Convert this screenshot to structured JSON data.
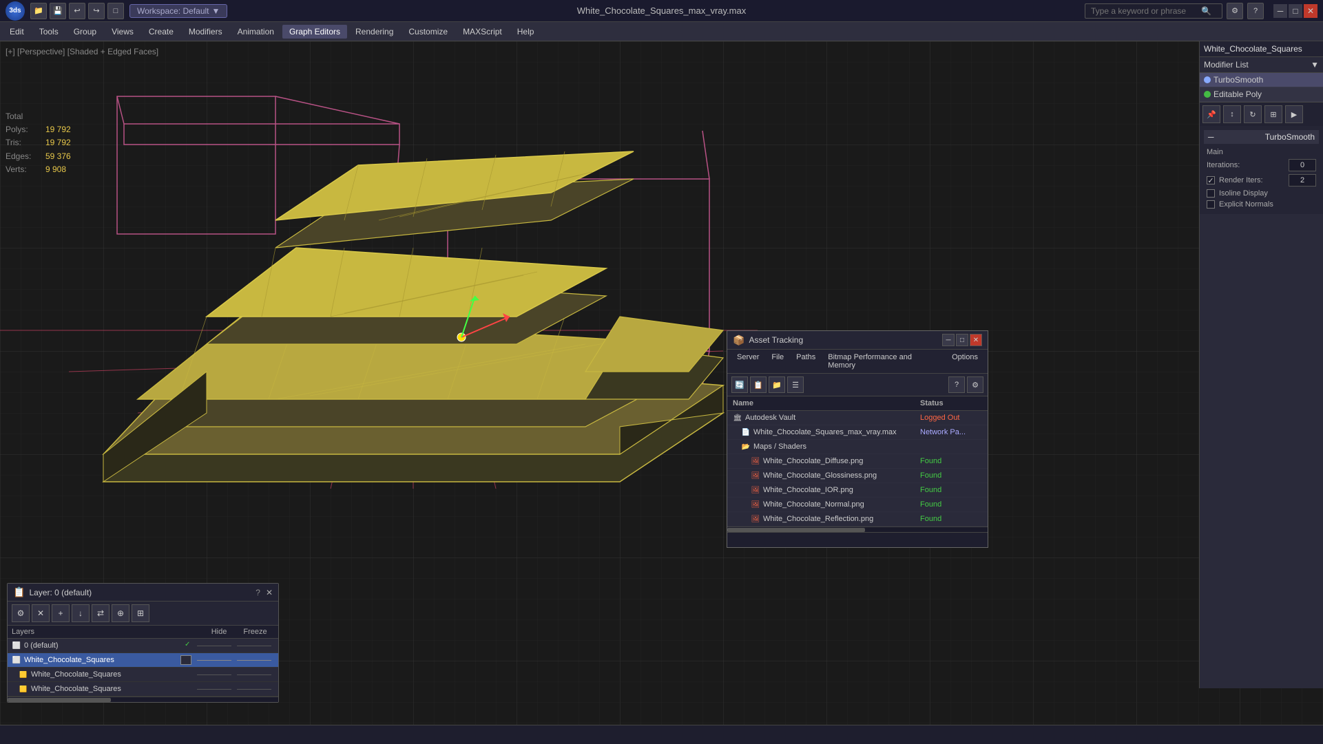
{
  "titlebar": {
    "logo": "3ds",
    "title": "White_Chocolate_Squares_max_vray.max",
    "workspace_label": "Workspace: Default",
    "search_placeholder": "Type a keyword or phrase",
    "min_label": "─",
    "max_label": "□",
    "close_label": "✕"
  },
  "toolbar_icons": [
    "📁",
    "💾",
    "↩",
    "↪",
    "□"
  ],
  "menubar": {
    "items": [
      "Edit",
      "Tools",
      "Group",
      "Views",
      "Create",
      "Modifiers",
      "Animation",
      "Graph Editors",
      "Rendering",
      "Customize",
      "MAXScript",
      "Help"
    ]
  },
  "viewport": {
    "label": "[+] [Perspective] [Shaded + Edged Faces]",
    "stats": {
      "polys_label": "Polys:",
      "polys_total": "Total",
      "polys_value": "19 792",
      "tris_label": "Tris:",
      "tris_value": "19 792",
      "edges_label": "Edges:",
      "edges_value": "59 376",
      "verts_label": "Verts:",
      "verts_value": "9 908"
    }
  },
  "right_panel": {
    "object_name": "White_Chocolate_Squares",
    "modifier_list_label": "Modifier List",
    "modifiers": [
      {
        "name": "TurboSmooth",
        "type": "blue"
      },
      {
        "name": "Editable Poly",
        "type": "green"
      }
    ],
    "turbosmooth": {
      "header": "TurboSmooth",
      "main_label": "Main",
      "iterations_label": "Iterations:",
      "iterations_value": "0",
      "render_iters_label": "Render Iters:",
      "render_iters_value": "2",
      "isoline_label": "Isoline Display",
      "explicit_label": "Explicit Normals"
    }
  },
  "layer_panel": {
    "title": "Layer: 0 (default)",
    "question_mark": "?",
    "close": "✕",
    "table_headers": {
      "name": "Layers",
      "hide": "Hide",
      "freeze": "Freeze"
    },
    "rows": [
      {
        "name": "0 (default)",
        "indent": 0,
        "selected": false,
        "check": true
      },
      {
        "name": "White_Chocolate_Squares",
        "indent": 0,
        "selected": true
      },
      {
        "name": "White_Chocolate_Squares",
        "indent": 1,
        "selected": false
      },
      {
        "name": "White_Chocolate_Squares",
        "indent": 1,
        "selected": false
      }
    ]
  },
  "asset_panel": {
    "title": "Asset Tracking",
    "table_headers": {
      "name": "Name",
      "status": "Status"
    },
    "menu_items": [
      "Server",
      "File",
      "Paths",
      "Bitmap Performance and Memory",
      "Options"
    ],
    "rows": [
      {
        "name": "Autodesk Vault",
        "indent": 0,
        "status": "Logged Out",
        "status_type": "logged-out",
        "icon": "vault"
      },
      {
        "name": "White_Chocolate_Squares_max_vray.max",
        "indent": 1,
        "status": "Network Pa...",
        "status_type": "network",
        "icon": "max"
      },
      {
        "name": "Maps / Shaders",
        "indent": 1,
        "status": "",
        "status_type": "",
        "icon": "maps"
      },
      {
        "name": "White_Chocolate_Diffuse.png",
        "indent": 2,
        "status": "Found",
        "status_type": "found",
        "icon": "png"
      },
      {
        "name": "White_Chocolate_Glossiness.png",
        "indent": 2,
        "status": "Found",
        "status_type": "found",
        "icon": "png"
      },
      {
        "name": "White_Chocolate_IOR.png",
        "indent": 2,
        "status": "Found",
        "status_type": "found",
        "icon": "png"
      },
      {
        "name": "White_Chocolate_Normal.png",
        "indent": 2,
        "status": "Found",
        "status_type": "found",
        "icon": "png"
      },
      {
        "name": "White_Chocolate_Reflection.png",
        "indent": 2,
        "status": "Found",
        "status_type": "found",
        "icon": "png"
      }
    ]
  },
  "statusbar": {
    "text": ""
  }
}
